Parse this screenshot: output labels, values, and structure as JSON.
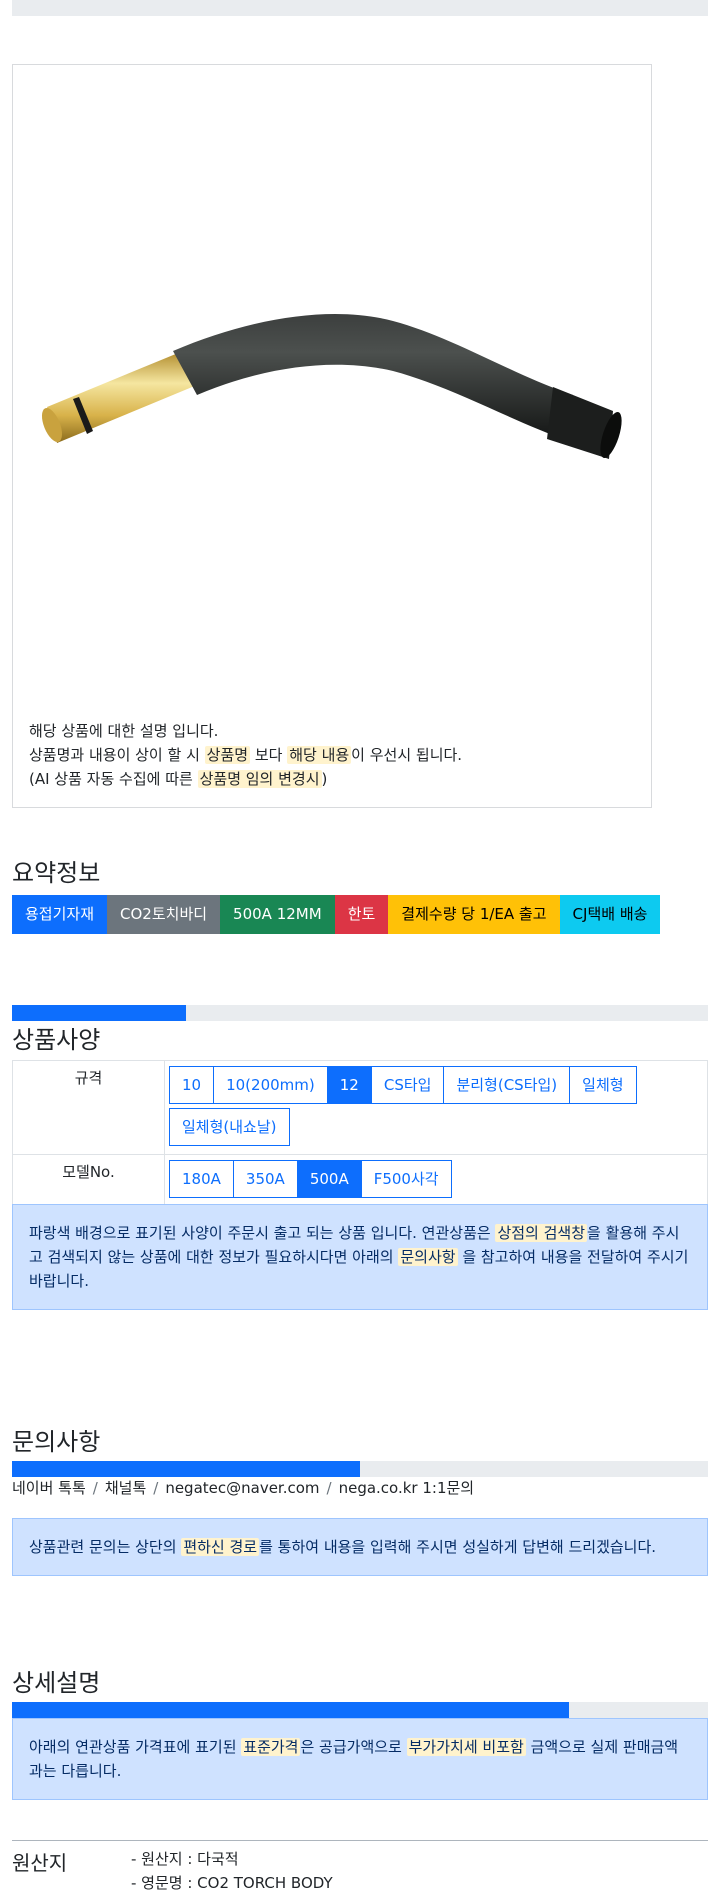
{
  "image_card": {
    "desc_line1": "해당 상품에 대한 설명 입니다.",
    "desc_line2_a": "상품명과 내용이 상이 할 시 ",
    "desc_line2_hl1": "상품명",
    "desc_line2_b": " 보다 ",
    "desc_line2_hl2": "해당 내용",
    "desc_line2_c": "이 우선시 됩니다.",
    "desc_line3_a": "(AI 상품 자동 수집에 따른 ",
    "desc_line3_hl": "상품명 임의 변경시",
    "desc_line3_b": ")"
  },
  "summary": {
    "title": "요약정보",
    "badges": [
      {
        "label": "용접기자재",
        "bg": "#0d6efd",
        "fg": "#ffffff"
      },
      {
        "label": "CO2토치바디",
        "bg": "#6c757d",
        "fg": "#ffffff"
      },
      {
        "label": "500A 12MM",
        "bg": "#198754",
        "fg": "#ffffff"
      },
      {
        "label": "한토",
        "bg": "#dc3545",
        "fg": "#ffffff"
      },
      {
        "label": "결제수량 당 1/EA 출고",
        "bg": "#ffc107",
        "fg": "#000000"
      },
      {
        "label": "CJ택배 배송",
        "bg": "#0dcaf0",
        "fg": "#000000"
      }
    ]
  },
  "spec": {
    "title": "상품사양",
    "progress": 0.25,
    "rows": [
      {
        "label": "규격",
        "options": [
          "10",
          "10(200mm)",
          "12",
          "CS타입",
          "분리형(CS타입)",
          "일체형",
          "일체형(내쇼날)"
        ],
        "active": 2
      },
      {
        "label": "모델No.",
        "options": [
          "180A",
          "350A",
          "500A",
          "F500사각"
        ],
        "active": 2
      }
    ],
    "notice_a": "파랑색 배경으로 표기된 사양이 주문시 출고 되는 상품 입니다. 연관상품은 ",
    "notice_hl1": "상점의 검색창",
    "notice_b": "을 활용해 주시고 검색되지 않는 상품에 대한 정보가 필요하시다면 아래의 ",
    "notice_hl2": "문의사항",
    "notice_c": " 을 참고하여 내용을 전달하여 주시기 바랍니다."
  },
  "inquiry": {
    "title": "문의사항",
    "progress": 0.5,
    "links": [
      "네이버 톡톡",
      "채널톡",
      "negatec@naver.com",
      "nega.co.kr 1:1문의"
    ],
    "separator": "/",
    "notice_a": "상품관련 문의는 상단의 ",
    "notice_hl": "편하신 경로",
    "notice_b": "를 통하여 내용을 입력해 주시면 성실하게 답변해 드리겠습니다."
  },
  "detail": {
    "title": "상세설명",
    "progress": 0.8,
    "notice_a": "아래의 연관상품 가격표에 표기된 ",
    "notice_hl1": "표준가격",
    "notice_b": "은 공급가액으로 ",
    "notice_hl2": "부가가치세 비포함",
    "notice_c": " 금액으로 실제 판매금액과는 다릅니다."
  },
  "origin": {
    "label": "원산지",
    "line1": "- 원산지 : 다국적",
    "line2": "- 영문명 : CO2 TORCH BODY"
  }
}
